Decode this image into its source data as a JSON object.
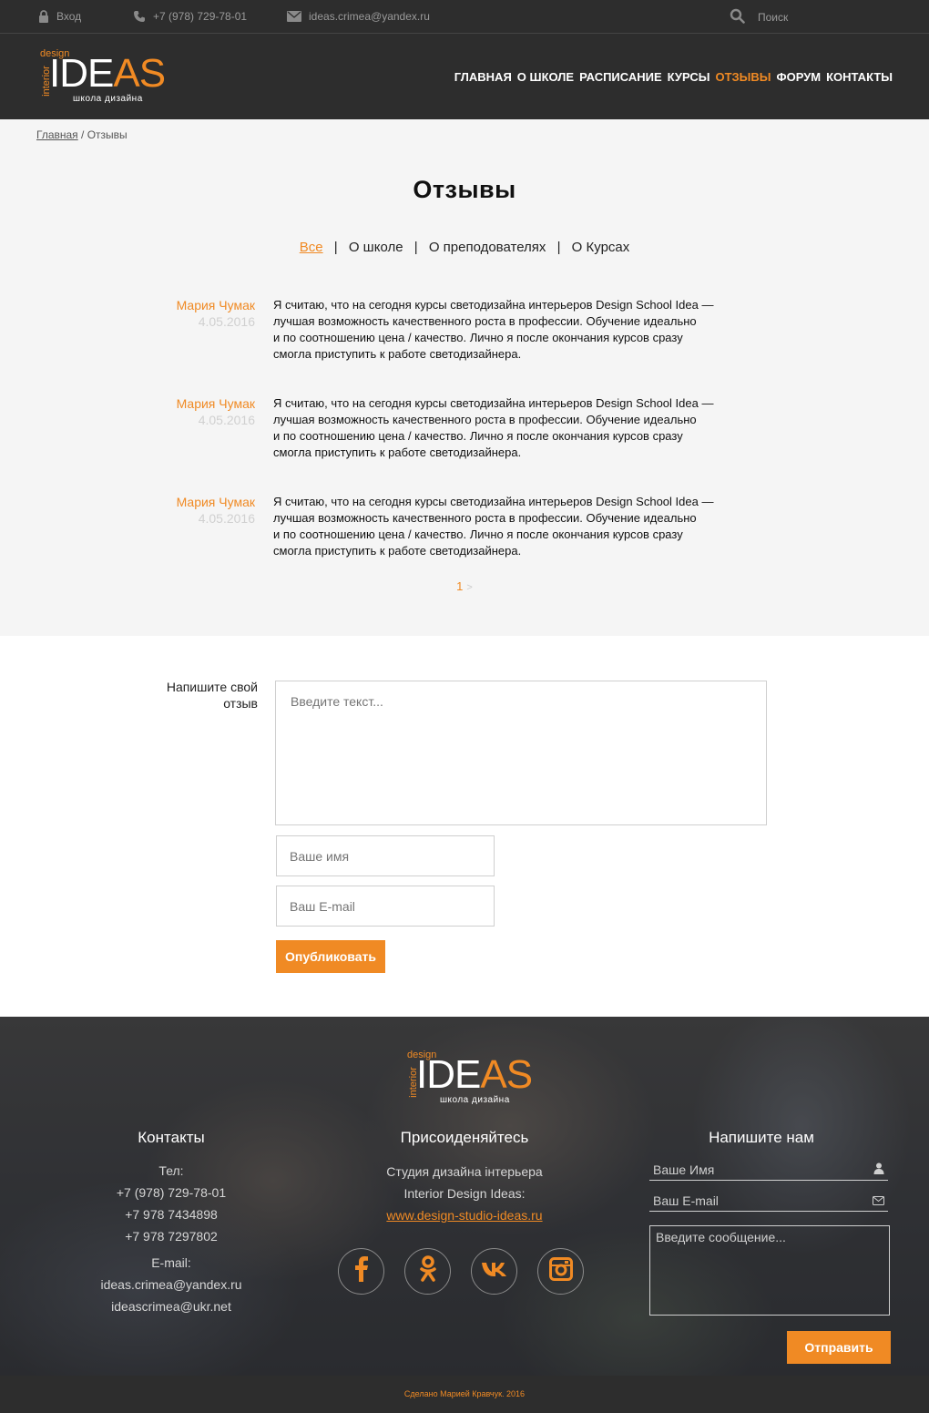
{
  "topbar": {
    "login": "Вход",
    "phone": "+7 (978) 729-78-01",
    "email": "ideas.crimea@yandex.ru",
    "search": "Поиск"
  },
  "logo": {
    "design": "design",
    "interior": "interior",
    "ideas_white": "IDE",
    "ideas_orange": "AS",
    "subtitle": "школа дизайна"
  },
  "nav": {
    "items": [
      "ГЛАВНАЯ",
      "О ШКОЛЕ",
      "РАСПИСАНИЕ",
      "КУРСЫ",
      "ОТЗЫВЫ",
      "ФОРУМ",
      "КОНТАКТЫ"
    ],
    "active": "ОТЗЫВЫ"
  },
  "breadcrumb": {
    "home": "Главная",
    "separator": " / ",
    "current": "Отзывы"
  },
  "page": {
    "title": "Отзывы"
  },
  "filters": {
    "items": [
      "Все",
      "О школе",
      "О преподователях",
      "О Курсах"
    ],
    "separator": "|"
  },
  "reviews": [
    {
      "name": "Мария Чумак",
      "date": "4.05.2016",
      "lines": [
        "Я считаю, что на сегодня курсы светодизайна интерьеров Design School Idea —",
        "лучшая возможность качественного роста в профессии. Обучение идеально",
        "и по соотношению цена / качество. Лично я после окончания курсов сразу",
        "смогла приступить к работе светодизайнера."
      ]
    },
    {
      "name": "Мария Чумак",
      "date": "4.05.2016",
      "lines": [
        "Я считаю, что на сегодня курсы светодизайна интерьеров Design School Idea —",
        "лучшая возможность качественного роста в профессии. Обучение идеально",
        "и по соотношению цена / качество. Лично я после окончания курсов сразу",
        "смогла приступить к работе светодизайнера."
      ]
    },
    {
      "name": "Мария Чумак",
      "date": "4.05.2016",
      "lines": [
        "Я считаю, что на сегодня курсы светодизайна интерьеров Design School Idea —",
        "лучшая возможность качественного роста в профессии. Обучение идеально",
        "и по соотношению цена / качество. Лично я после окончания курсов сразу",
        "смогла приступить к работе светодизайнера."
      ]
    }
  ],
  "pager": {
    "current": "1",
    "next": ">"
  },
  "review_form": {
    "label_line1": "Напишите свой",
    "label_line2": "отзыв",
    "text_placeholder": "Введите текст...",
    "name_placeholder": "Ваше имя",
    "email_placeholder": "Ваш E-mail",
    "submit": "Опубликовать"
  },
  "footer": {
    "contacts": {
      "title": "Контакты",
      "tel_label": "Тел:",
      "phones": [
        "+7 (978) 729-78-01",
        "+7 978 7434898",
        "+7 978 7297802"
      ],
      "email_label": "E-mail:",
      "emails": [
        "ideas.crimea@yandex.ru",
        "ideascrimea@ukr.net"
      ]
    },
    "join": {
      "title": "Присоиденяйтесь",
      "line1": "Студия дизайна інтерьера",
      "line2": "Interior Design Ideas:",
      "link": "www.design-studio-ideas.ru",
      "social": [
        "facebook-icon",
        "odnoklassniki-icon",
        "vk-icon",
        "instagram-icon"
      ]
    },
    "write": {
      "title": "Напишите нам",
      "name_placeholder": "Ваше Имя",
      "email_placeholder": "Ваш E-mail",
      "message_placeholder": "Введите сообщение...",
      "submit": "Отправить"
    }
  },
  "copyright": "Сделано Марией Кравчук. 2016",
  "colors": {
    "accent": "#f08a24",
    "dark": "#2d2d2d",
    "content_bg": "#f5f5f5"
  }
}
